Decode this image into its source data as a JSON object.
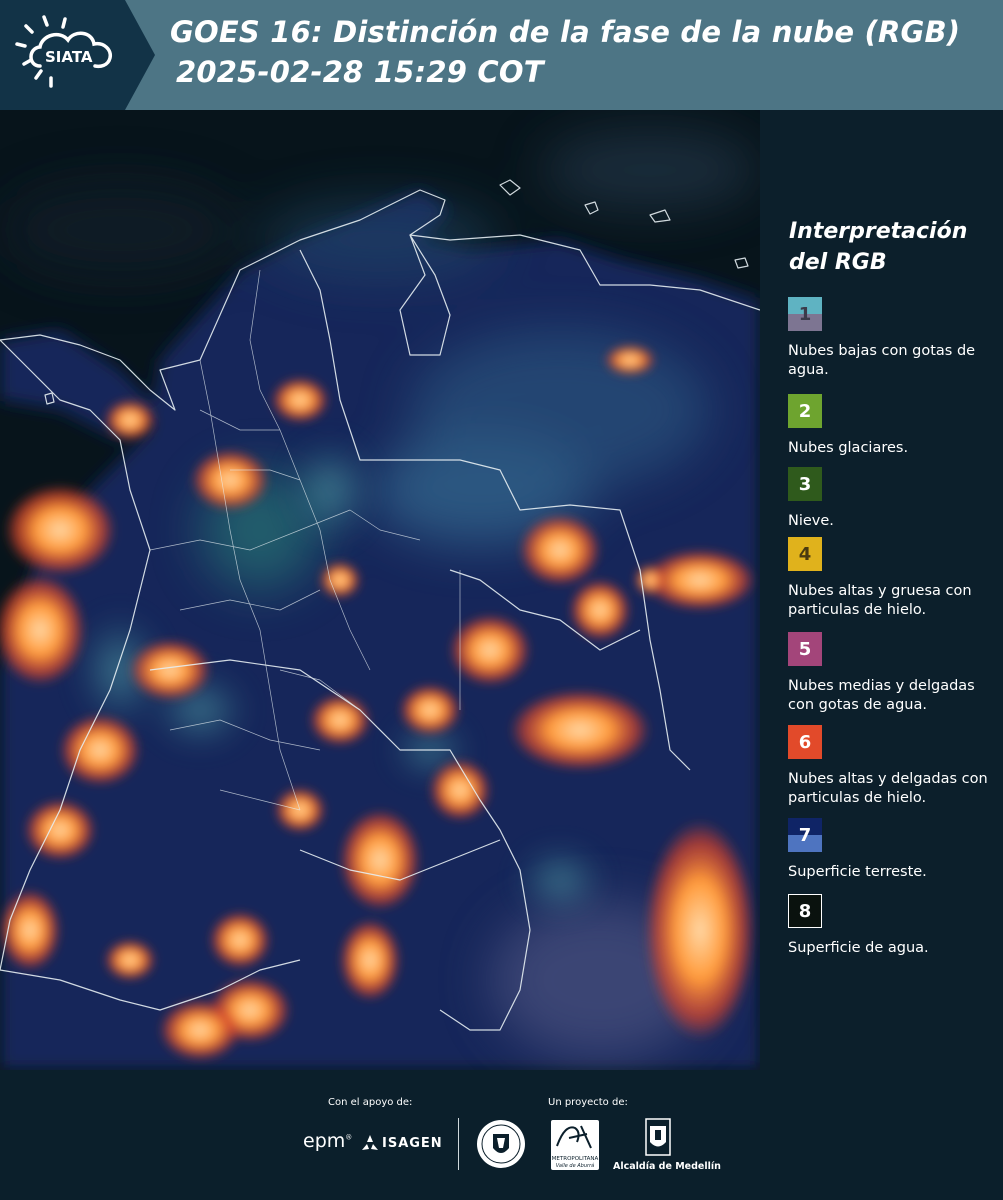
{
  "header": {
    "logo_text": "SIATA",
    "title_line1": "GOES 16: Distinción de la fase de la nube (RGB)",
    "title_line2": "2025-02-28 15:29 COT"
  },
  "map": {
    "icon": "satellite-map"
  },
  "legend": {
    "title_line1": "Interpretación",
    "title_line2": "del RGB",
    "items": [
      {
        "number": "1",
        "label": "Nubes bajas con gotas de agua.",
        "color_top": "#5fb3c2",
        "color_bottom": "#7d7592"
      },
      {
        "number": "2",
        "label": "Nubes glaciares.",
        "color": "#6ea42f"
      },
      {
        "number": "3",
        "label": "Nieve.",
        "color": "#2f5a1c"
      },
      {
        "number": "4",
        "label": "Nubes altas y gruesa con particulas de hielo.",
        "color": "#e0b21c"
      },
      {
        "number": "5",
        "label": "Nubes medias y delgadas con gotas de agua.",
        "color": "#a3457a"
      },
      {
        "number": "6",
        "label": "Nubes altas y delgadas con particulas de hielo.",
        "color": "#e24a2a"
      },
      {
        "number": "7",
        "label": "Superficie terreste.",
        "color_top": "#0f2466",
        "color_bottom": "#4e74c0"
      },
      {
        "number": "8",
        "label": "Superficie de agua.",
        "color": "#0a120e"
      }
    ]
  },
  "footer": {
    "support_label": "Con el apoyo de:",
    "project_label": "Un proyecto de:",
    "sponsor_epm": "epm",
    "sponsor_isagen": "ISAGEN",
    "area_label": "METROPOLITANA",
    "area_sub": "Valle de Aburrá",
    "alcaldia": "Alcaldía de Medellín"
  }
}
